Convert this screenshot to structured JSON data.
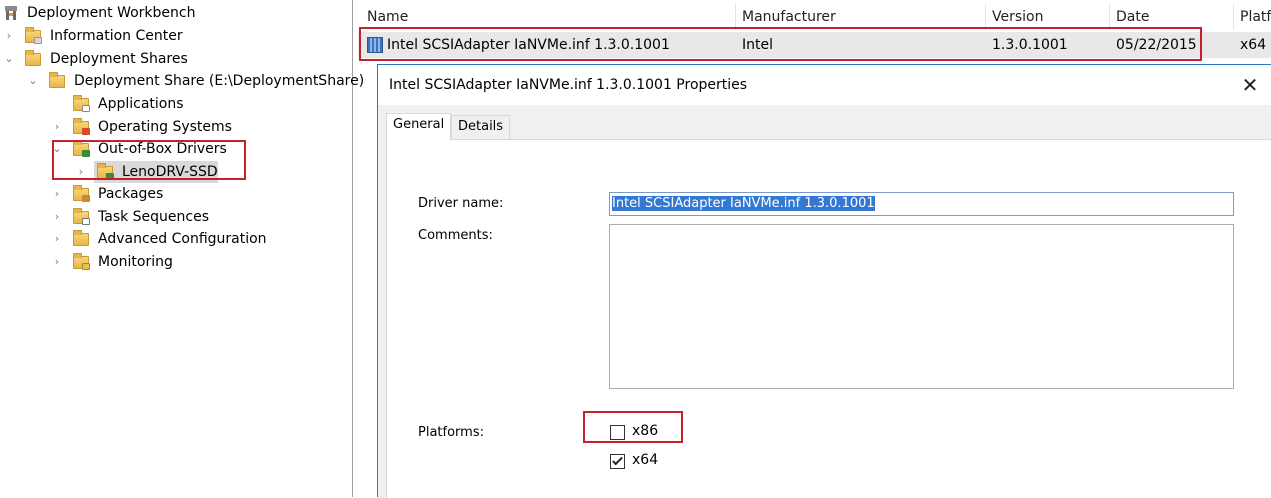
{
  "tree": {
    "items": [
      {
        "label": "Deployment Workbench",
        "arrow": "",
        "icon": "workbench-icon"
      },
      {
        "label": "Information Center",
        "arrow": "›",
        "icon": "folder-icon"
      },
      {
        "label": "Deployment Shares",
        "arrow": "⌄",
        "icon": "folder-icon"
      },
      {
        "label": "Deployment Share (E:\\DeploymentShare)",
        "arrow": "⌄",
        "icon": "folder-open-icon"
      },
      {
        "label": "Applications",
        "arrow": "",
        "icon": "folder-icon"
      },
      {
        "label": "Operating Systems",
        "arrow": "›",
        "icon": "folder-icon"
      },
      {
        "label": "Out-of-Box Drivers",
        "arrow": "⌄",
        "icon": "folder-icon"
      },
      {
        "label": "LenoDRV-SSD",
        "arrow": "›",
        "icon": "folder-icon"
      },
      {
        "label": "Packages",
        "arrow": "›",
        "icon": "folder-icon"
      },
      {
        "label": "Task Sequences",
        "arrow": "›",
        "icon": "folder-icon"
      },
      {
        "label": "Advanced Configuration",
        "arrow": "›",
        "icon": "folder-icon"
      },
      {
        "label": "Monitoring",
        "arrow": "›",
        "icon": "folder-icon"
      }
    ]
  },
  "list": {
    "columns": [
      "Name",
      "Manufacturer",
      "Version",
      "Date",
      "Platf"
    ],
    "row": {
      "name": "Intel SCSIAdapter IaNVMe.inf 1.3.0.1001",
      "manufacturer": "Intel",
      "version": "1.3.0.1001",
      "date": "05/22/2015",
      "platform": "x64"
    }
  },
  "dialog": {
    "title": "Intel SCSIAdapter IaNVMe.inf 1.3.0.1001 Properties",
    "close": "✕",
    "tabs": [
      "General",
      "Details"
    ],
    "active_tab": "General",
    "fields": {
      "driver_name_label": "Driver name:",
      "driver_name_value": "Intel SCSIAdapter IaNVMe.inf 1.3.0.1001",
      "comments_label": "Comments:",
      "comments_value": "",
      "platforms_label": "Platforms:",
      "platforms": [
        {
          "label": "x86",
          "checked": false
        },
        {
          "label": "x64",
          "checked": true
        }
      ]
    }
  },
  "colors": {
    "highlight": "#c8202b",
    "selection": "#3478d4",
    "dialog_border": "#2b78c5"
  }
}
